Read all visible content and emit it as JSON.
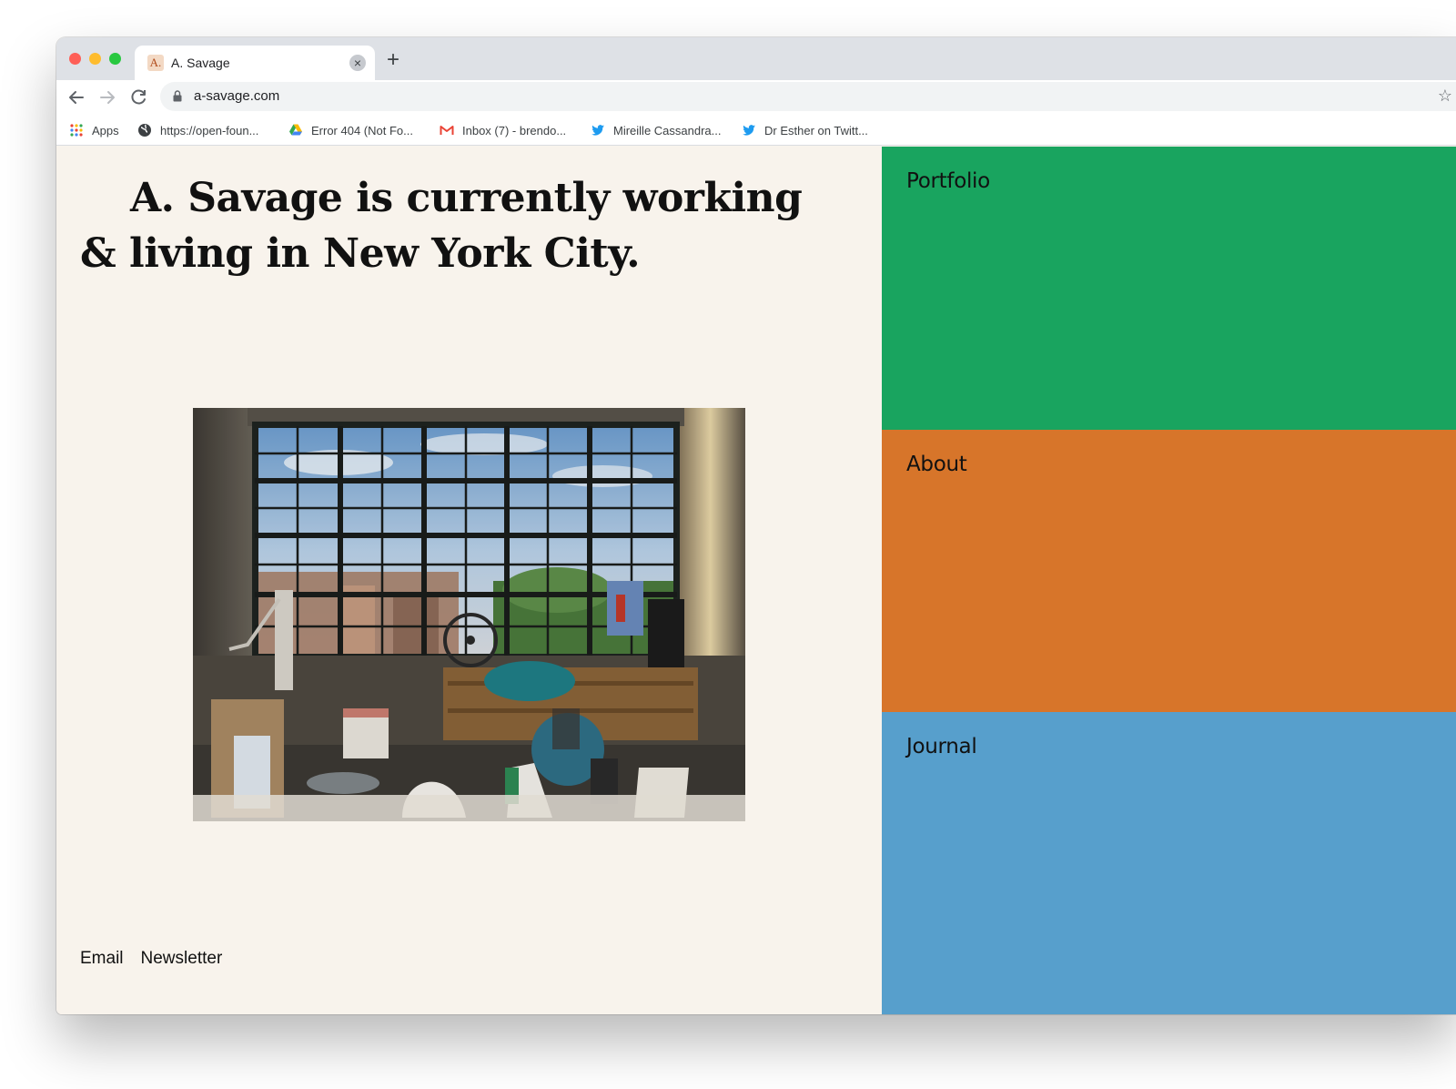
{
  "browser": {
    "tab_title": "A. Savage",
    "tab_favicon_text": "A.",
    "new_tab_symbol": "+",
    "tab_close_symbol": "×",
    "url": "a-savage.com",
    "bookmarks": [
      {
        "label": "Apps",
        "icon": "apps-grid-icon"
      },
      {
        "label": "https://open-foun...",
        "icon": "globe-icon"
      },
      {
        "label": "Error 404 (Not Fo...",
        "icon": "google-drive-icon"
      },
      {
        "label": "Inbox (7) - brendo...",
        "icon": "gmail-icon"
      },
      {
        "label": "Mireille Cassandra...",
        "icon": "twitter-icon"
      },
      {
        "label": "Dr Esther on Twitt...",
        "icon": "twitter-icon"
      }
    ]
  },
  "page": {
    "headline": "A. Savage is currently working & living in New York City.",
    "photo_alt": "studio",
    "footer_links": [
      "Email",
      "Newsletter"
    ],
    "nav_panels": [
      {
        "label": "Portfolio",
        "color": "#19a45f"
      },
      {
        "label": "About",
        "color": "#d7752a"
      },
      {
        "label": "Journal",
        "color": "#579fcc"
      }
    ],
    "background_color": "#f8f3ec"
  }
}
